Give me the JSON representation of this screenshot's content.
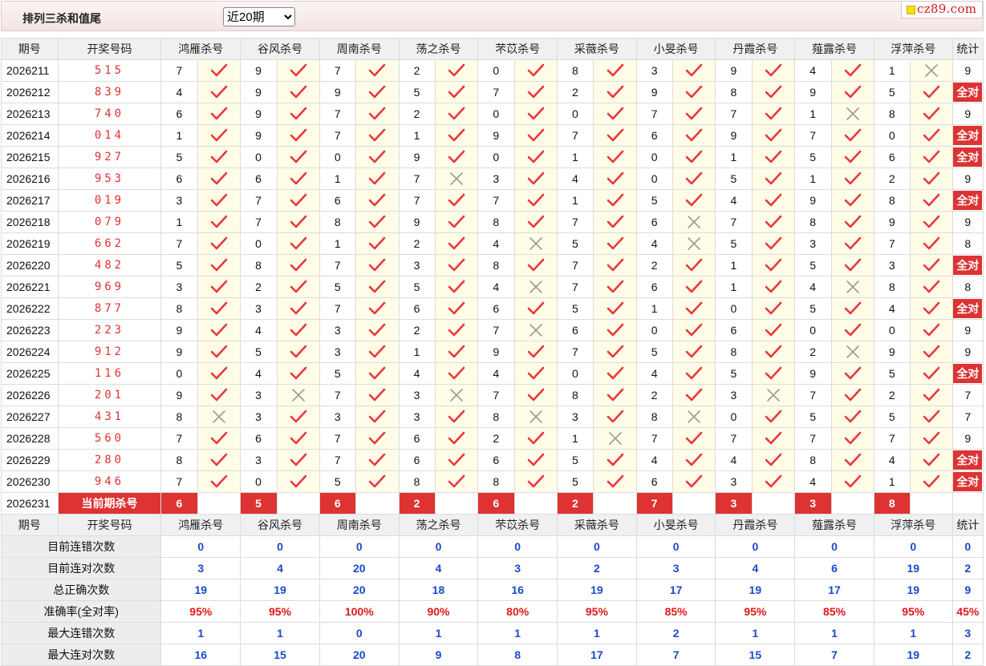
{
  "header": {
    "title": "排列三杀和值尾",
    "period_selected": "近20期",
    "period_options": [
      "近20期"
    ],
    "logo": "cz89.com"
  },
  "columns": {
    "period": "期号",
    "draw": "开奖号码",
    "killers": [
      "鸿雁杀号",
      "谷风杀号",
      "周南杀号",
      "荡之杀号",
      "芣苡杀号",
      "采薇杀号",
      "小旻杀号",
      "丹霞杀号",
      "薤露杀号",
      "浮萍杀号"
    ],
    "stat": "统计"
  },
  "rows": [
    {
      "period": "2026211",
      "draw": "515",
      "kills": [
        "7",
        "9",
        "7",
        "2",
        "0",
        "8",
        "3",
        "9",
        "4",
        "1"
      ],
      "marks": [
        1,
        1,
        1,
        1,
        1,
        1,
        1,
        1,
        1,
        0
      ],
      "stat": "9"
    },
    {
      "period": "2026212",
      "draw": "839",
      "kills": [
        "4",
        "9",
        "9",
        "5",
        "7",
        "2",
        "9",
        "8",
        "9",
        "5"
      ],
      "marks": [
        1,
        1,
        1,
        1,
        1,
        1,
        1,
        1,
        1,
        1
      ],
      "stat": "全对"
    },
    {
      "period": "2026213",
      "draw": "740",
      "kills": [
        "6",
        "9",
        "7",
        "2",
        "0",
        "0",
        "7",
        "7",
        "1",
        "8"
      ],
      "marks": [
        1,
        1,
        1,
        1,
        1,
        1,
        1,
        1,
        0,
        1
      ],
      "stat": "9"
    },
    {
      "period": "2026214",
      "draw": "014",
      "kills": [
        "1",
        "9",
        "7",
        "1",
        "9",
        "7",
        "6",
        "9",
        "7",
        "0"
      ],
      "marks": [
        1,
        1,
        1,
        1,
        1,
        1,
        1,
        1,
        1,
        1
      ],
      "stat": "全对"
    },
    {
      "period": "2026215",
      "draw": "927",
      "kills": [
        "5",
        "0",
        "0",
        "9",
        "0",
        "1",
        "0",
        "1",
        "5",
        "6"
      ],
      "marks": [
        1,
        1,
        1,
        1,
        1,
        1,
        1,
        1,
        1,
        1
      ],
      "stat": "全对"
    },
    {
      "period": "2026216",
      "draw": "953",
      "kills": [
        "6",
        "6",
        "1",
        "7",
        "3",
        "4",
        "0",
        "5",
        "1",
        "2"
      ],
      "marks": [
        1,
        1,
        1,
        0,
        1,
        1,
        1,
        1,
        1,
        1
      ],
      "stat": "9"
    },
    {
      "period": "2026217",
      "draw": "019",
      "kills": [
        "3",
        "7",
        "6",
        "7",
        "7",
        "1",
        "5",
        "4",
        "9",
        "8"
      ],
      "marks": [
        1,
        1,
        1,
        1,
        1,
        1,
        1,
        1,
        1,
        1
      ],
      "stat": "全对"
    },
    {
      "period": "2026218",
      "draw": "079",
      "kills": [
        "1",
        "7",
        "8",
        "9",
        "8",
        "7",
        "6",
        "7",
        "8",
        "9"
      ],
      "marks": [
        1,
        1,
        1,
        1,
        1,
        1,
        0,
        1,
        1,
        1
      ],
      "stat": "9"
    },
    {
      "period": "2026219",
      "draw": "662",
      "kills": [
        "7",
        "0",
        "1",
        "2",
        "4",
        "5",
        "4",
        "5",
        "3",
        "7"
      ],
      "marks": [
        1,
        1,
        1,
        1,
        0,
        1,
        0,
        1,
        1,
        1
      ],
      "stat": "8"
    },
    {
      "period": "2026220",
      "draw": "482",
      "kills": [
        "5",
        "8",
        "7",
        "3",
        "8",
        "7",
        "2",
        "1",
        "5",
        "3"
      ],
      "marks": [
        1,
        1,
        1,
        1,
        1,
        1,
        1,
        1,
        1,
        1
      ],
      "stat": "全对"
    },
    {
      "period": "2026221",
      "draw": "969",
      "kills": [
        "3",
        "2",
        "5",
        "5",
        "4",
        "7",
        "6",
        "1",
        "4",
        "8"
      ],
      "marks": [
        1,
        1,
        1,
        1,
        0,
        1,
        1,
        1,
        0,
        1
      ],
      "stat": "8"
    },
    {
      "period": "2026222",
      "draw": "877",
      "kills": [
        "8",
        "3",
        "7",
        "6",
        "6",
        "5",
        "1",
        "0",
        "5",
        "4"
      ],
      "marks": [
        1,
        1,
        1,
        1,
        1,
        1,
        1,
        1,
        1,
        1
      ],
      "stat": "全对"
    },
    {
      "period": "2026223",
      "draw": "223",
      "kills": [
        "9",
        "4",
        "3",
        "2",
        "7",
        "6",
        "0",
        "6",
        "0",
        "0"
      ],
      "marks": [
        1,
        1,
        1,
        1,
        0,
        1,
        1,
        1,
        1,
        1
      ],
      "stat": "9"
    },
    {
      "period": "2026224",
      "draw": "912",
      "kills": [
        "9",
        "5",
        "3",
        "1",
        "9",
        "7",
        "5",
        "8",
        "2",
        "9"
      ],
      "marks": [
        1,
        1,
        1,
        1,
        1,
        1,
        1,
        1,
        0,
        1
      ],
      "stat": "9"
    },
    {
      "period": "2026225",
      "draw": "116",
      "kills": [
        "0",
        "4",
        "5",
        "4",
        "4",
        "0",
        "4",
        "5",
        "9",
        "5"
      ],
      "marks": [
        1,
        1,
        1,
        1,
        1,
        1,
        1,
        1,
        1,
        1
      ],
      "stat": "全对"
    },
    {
      "period": "2026226",
      "draw": "201",
      "kills": [
        "9",
        "3",
        "7",
        "3",
        "7",
        "8",
        "2",
        "3",
        "7",
        "2"
      ],
      "marks": [
        1,
        0,
        1,
        0,
        1,
        1,
        1,
        0,
        1,
        1
      ],
      "stat": "7"
    },
    {
      "period": "2026227",
      "draw": "431",
      "kills": [
        "8",
        "3",
        "3",
        "3",
        "8",
        "3",
        "8",
        "0",
        "5",
        "5"
      ],
      "marks": [
        0,
        1,
        1,
        1,
        0,
        1,
        0,
        1,
        1,
        1
      ],
      "stat": "7"
    },
    {
      "period": "2026228",
      "draw": "560",
      "kills": [
        "7",
        "6",
        "7",
        "6",
        "2",
        "1",
        "7",
        "7",
        "7",
        "7"
      ],
      "marks": [
        1,
        1,
        1,
        1,
        1,
        0,
        1,
        1,
        1,
        1
      ],
      "stat": "9"
    },
    {
      "period": "2026229",
      "draw": "280",
      "kills": [
        "8",
        "3",
        "7",
        "6",
        "6",
        "5",
        "4",
        "4",
        "8",
        "4"
      ],
      "marks": [
        1,
        1,
        1,
        1,
        1,
        1,
        1,
        1,
        1,
        1
      ],
      "stat": "全对"
    },
    {
      "period": "2026230",
      "draw": "946",
      "kills": [
        "7",
        "0",
        "5",
        "8",
        "8",
        "5",
        "6",
        "3",
        "4",
        "1"
      ],
      "marks": [
        1,
        1,
        1,
        1,
        1,
        1,
        1,
        1,
        1,
        1
      ],
      "stat": "全对"
    }
  ],
  "current": {
    "period": "2026231",
    "label": "当前期杀号",
    "kills": [
      "6",
      "5",
      "6",
      "2",
      "6",
      "2",
      "7",
      "3",
      "3",
      "8"
    ]
  },
  "summary": [
    {
      "label": "目前连错次数",
      "values": [
        "0",
        "0",
        "0",
        "0",
        "0",
        "0",
        "0",
        "0",
        "0",
        "0"
      ],
      "stat": "0",
      "pct": false
    },
    {
      "label": "目前连对次数",
      "values": [
        "3",
        "4",
        "20",
        "4",
        "3",
        "2",
        "3",
        "4",
        "6",
        "19"
      ],
      "stat": "2",
      "pct": false
    },
    {
      "label": "总正确次数",
      "values": [
        "19",
        "19",
        "20",
        "18",
        "16",
        "19",
        "17",
        "19",
        "17",
        "19"
      ],
      "stat": "9",
      "pct": false
    },
    {
      "label": "准确率(全对率)",
      "values": [
        "95%",
        "95%",
        "100%",
        "90%",
        "80%",
        "95%",
        "85%",
        "95%",
        "85%",
        "95%"
      ],
      "stat": "45%",
      "pct": true
    },
    {
      "label": "最大连错次数",
      "values": [
        "1",
        "1",
        "0",
        "1",
        "1",
        "1",
        "2",
        "1",
        "1",
        "1"
      ],
      "stat": "3",
      "pct": false
    },
    {
      "label": "最大连对次数",
      "values": [
        "16",
        "15",
        "20",
        "9",
        "8",
        "17",
        "7",
        "15",
        "7",
        "19"
      ],
      "stat": "2",
      "pct": false
    }
  ],
  "colors": {
    "accent_red": "#dd3333",
    "value_blue": "#1a4acb",
    "check_red": "#e8383d",
    "cross_gray": "#9a9a9a"
  },
  "icons": {
    "correct": "check-icon",
    "wrong": "cross-icon"
  }
}
